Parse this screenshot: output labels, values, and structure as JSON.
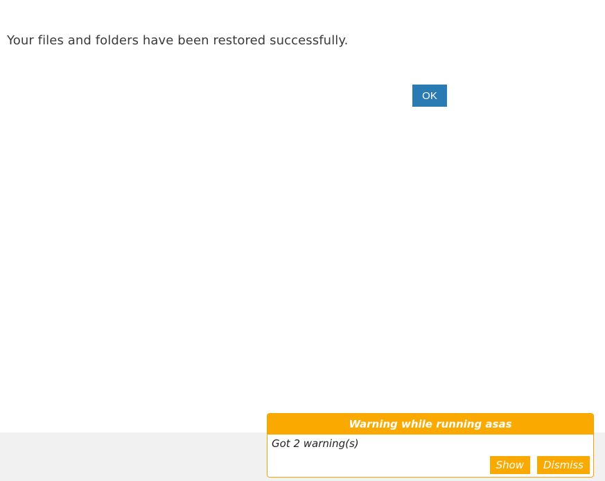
{
  "dialog": {
    "message": "Your files and folders have been restored successfully.",
    "ok_label": "OK",
    "accent_color": "#2a7ab4"
  },
  "warning": {
    "title": "Warning while running asas",
    "body": "Got 2 warning(s)",
    "show_label": "Show",
    "dismiss_label": "Dismiss",
    "accent_color": "#f9a900"
  }
}
